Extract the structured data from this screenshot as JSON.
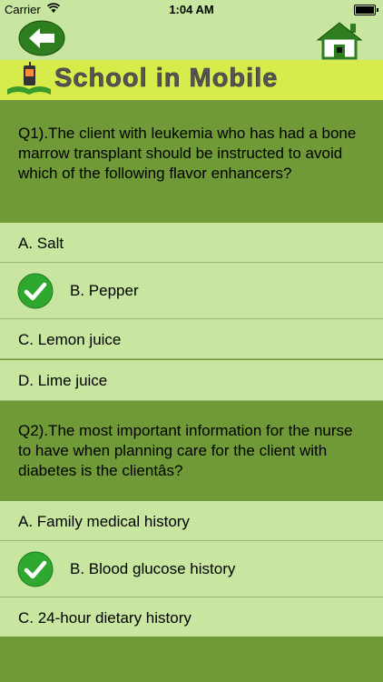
{
  "status": {
    "carrier": "Carrier",
    "time": "1:04 AM"
  },
  "banner": {
    "title": "School in Mobile"
  },
  "questions": [
    {
      "text": "Q1).The client with leukemia who has had a bone marrow transplant should be instructed to avoid which of the following flavor enhancers?",
      "options": [
        "A. Salt",
        "B. Pepper",
        "C. Lemon juice",
        "D. Lime juice"
      ],
      "correct_index": 1
    },
    {
      "text": "Q2).The most important information for the nurse to have when planning care for the client with diabetes is the clientâs?",
      "options": [
        "A. Family medical history",
        "B. Blood glucose history",
        "C. 24-hour dietary history"
      ],
      "correct_index": 1
    }
  ],
  "colors": {
    "dark_green": "#6f9a37",
    "light_green": "#c8e6a0",
    "banner": "#d7eb4a",
    "check": "#2fa82f"
  }
}
